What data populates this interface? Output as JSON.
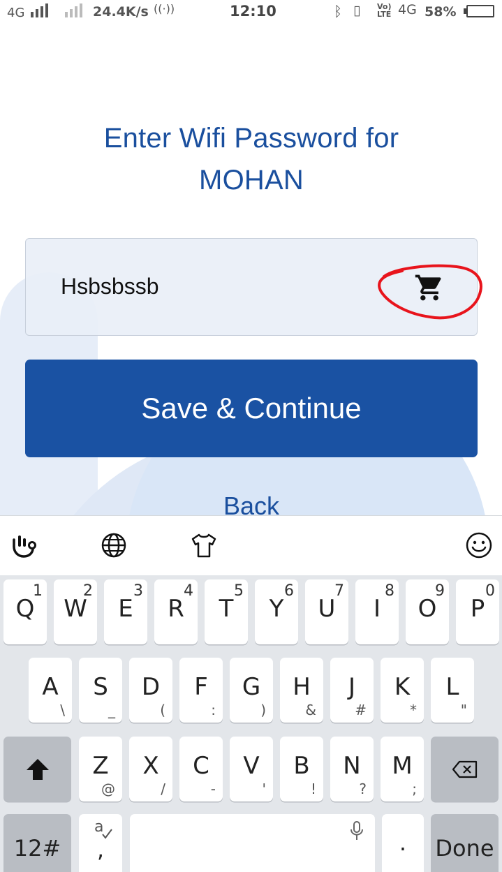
{
  "status_bar": {
    "network": "4G",
    "speed": "24.4K/s",
    "time": "12:10",
    "battery": "58%"
  },
  "title_line1": "Enter Wifi Password for",
  "title_line2": "MOHAN",
  "password_value": "Hsbsbssb",
  "save_button_label": "Save & Continue",
  "back_link_label": "Back",
  "keyboard": {
    "row1": [
      {
        "key": "Q",
        "alt": "1"
      },
      {
        "key": "W",
        "alt": "2"
      },
      {
        "key": "E",
        "alt": "3"
      },
      {
        "key": "R",
        "alt": "4"
      },
      {
        "key": "T",
        "alt": "5"
      },
      {
        "key": "Y",
        "alt": "6"
      },
      {
        "key": "U",
        "alt": "7"
      },
      {
        "key": "I",
        "alt": "8"
      },
      {
        "key": "O",
        "alt": "9"
      },
      {
        "key": "P",
        "alt": "0"
      }
    ],
    "row2": [
      {
        "key": "A",
        "sub": "\\"
      },
      {
        "key": "S",
        "sub": "_"
      },
      {
        "key": "D",
        "sub": "("
      },
      {
        "key": "F",
        "sub": ":"
      },
      {
        "key": "G",
        "sub": ")"
      },
      {
        "key": "H",
        "sub": "&"
      },
      {
        "key": "J",
        "sub": "#"
      },
      {
        "key": "K",
        "sub": "*"
      },
      {
        "key": "L",
        "sub": "\""
      }
    ],
    "row3": [
      {
        "key": "Z",
        "sub": "@"
      },
      {
        "key": "X",
        "sub": "/"
      },
      {
        "key": "C",
        "sub": "-"
      },
      {
        "key": "V",
        "sub": "'"
      },
      {
        "key": "B",
        "sub": "!"
      },
      {
        "key": "N",
        "sub": "?"
      },
      {
        "key": "M",
        "sub": ";"
      }
    ],
    "numbers_key": "12#",
    "comma_key": ",",
    "period_key": ".",
    "done_key": "Done"
  },
  "colors": {
    "accent": "#1a52a3",
    "title": "#1a4f9e",
    "annotation": "#e8141c"
  }
}
